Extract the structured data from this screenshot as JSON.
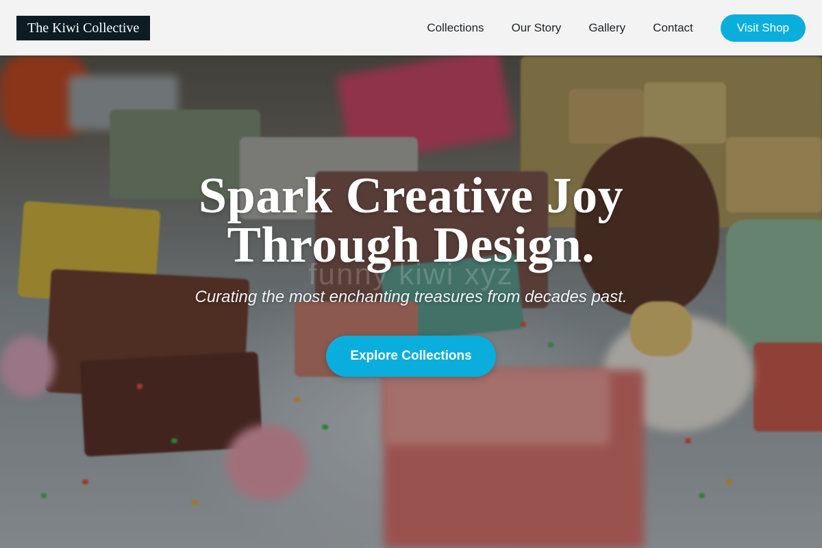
{
  "brand": {
    "name": "The Kiwi Collective"
  },
  "nav": {
    "links": [
      "Collections",
      "Our Story",
      "Gallery",
      "Contact"
    ],
    "cta_label": "Visit Shop"
  },
  "hero": {
    "headline_line1": "Spark Creative Joy",
    "headline_line2": "Through Design.",
    "watermark": "funny kiwi xyz",
    "subheadline": "Curating the most enchanting treasures from decades past.",
    "cta_label": "Explore Collections"
  },
  "colors": {
    "accent": "#0aaedc",
    "logo_bg": "#0c1c24",
    "nav_bg": "#ffffff",
    "text_dark": "#1d2327"
  },
  "background": {
    "icon": "handmade-soap-photo"
  }
}
